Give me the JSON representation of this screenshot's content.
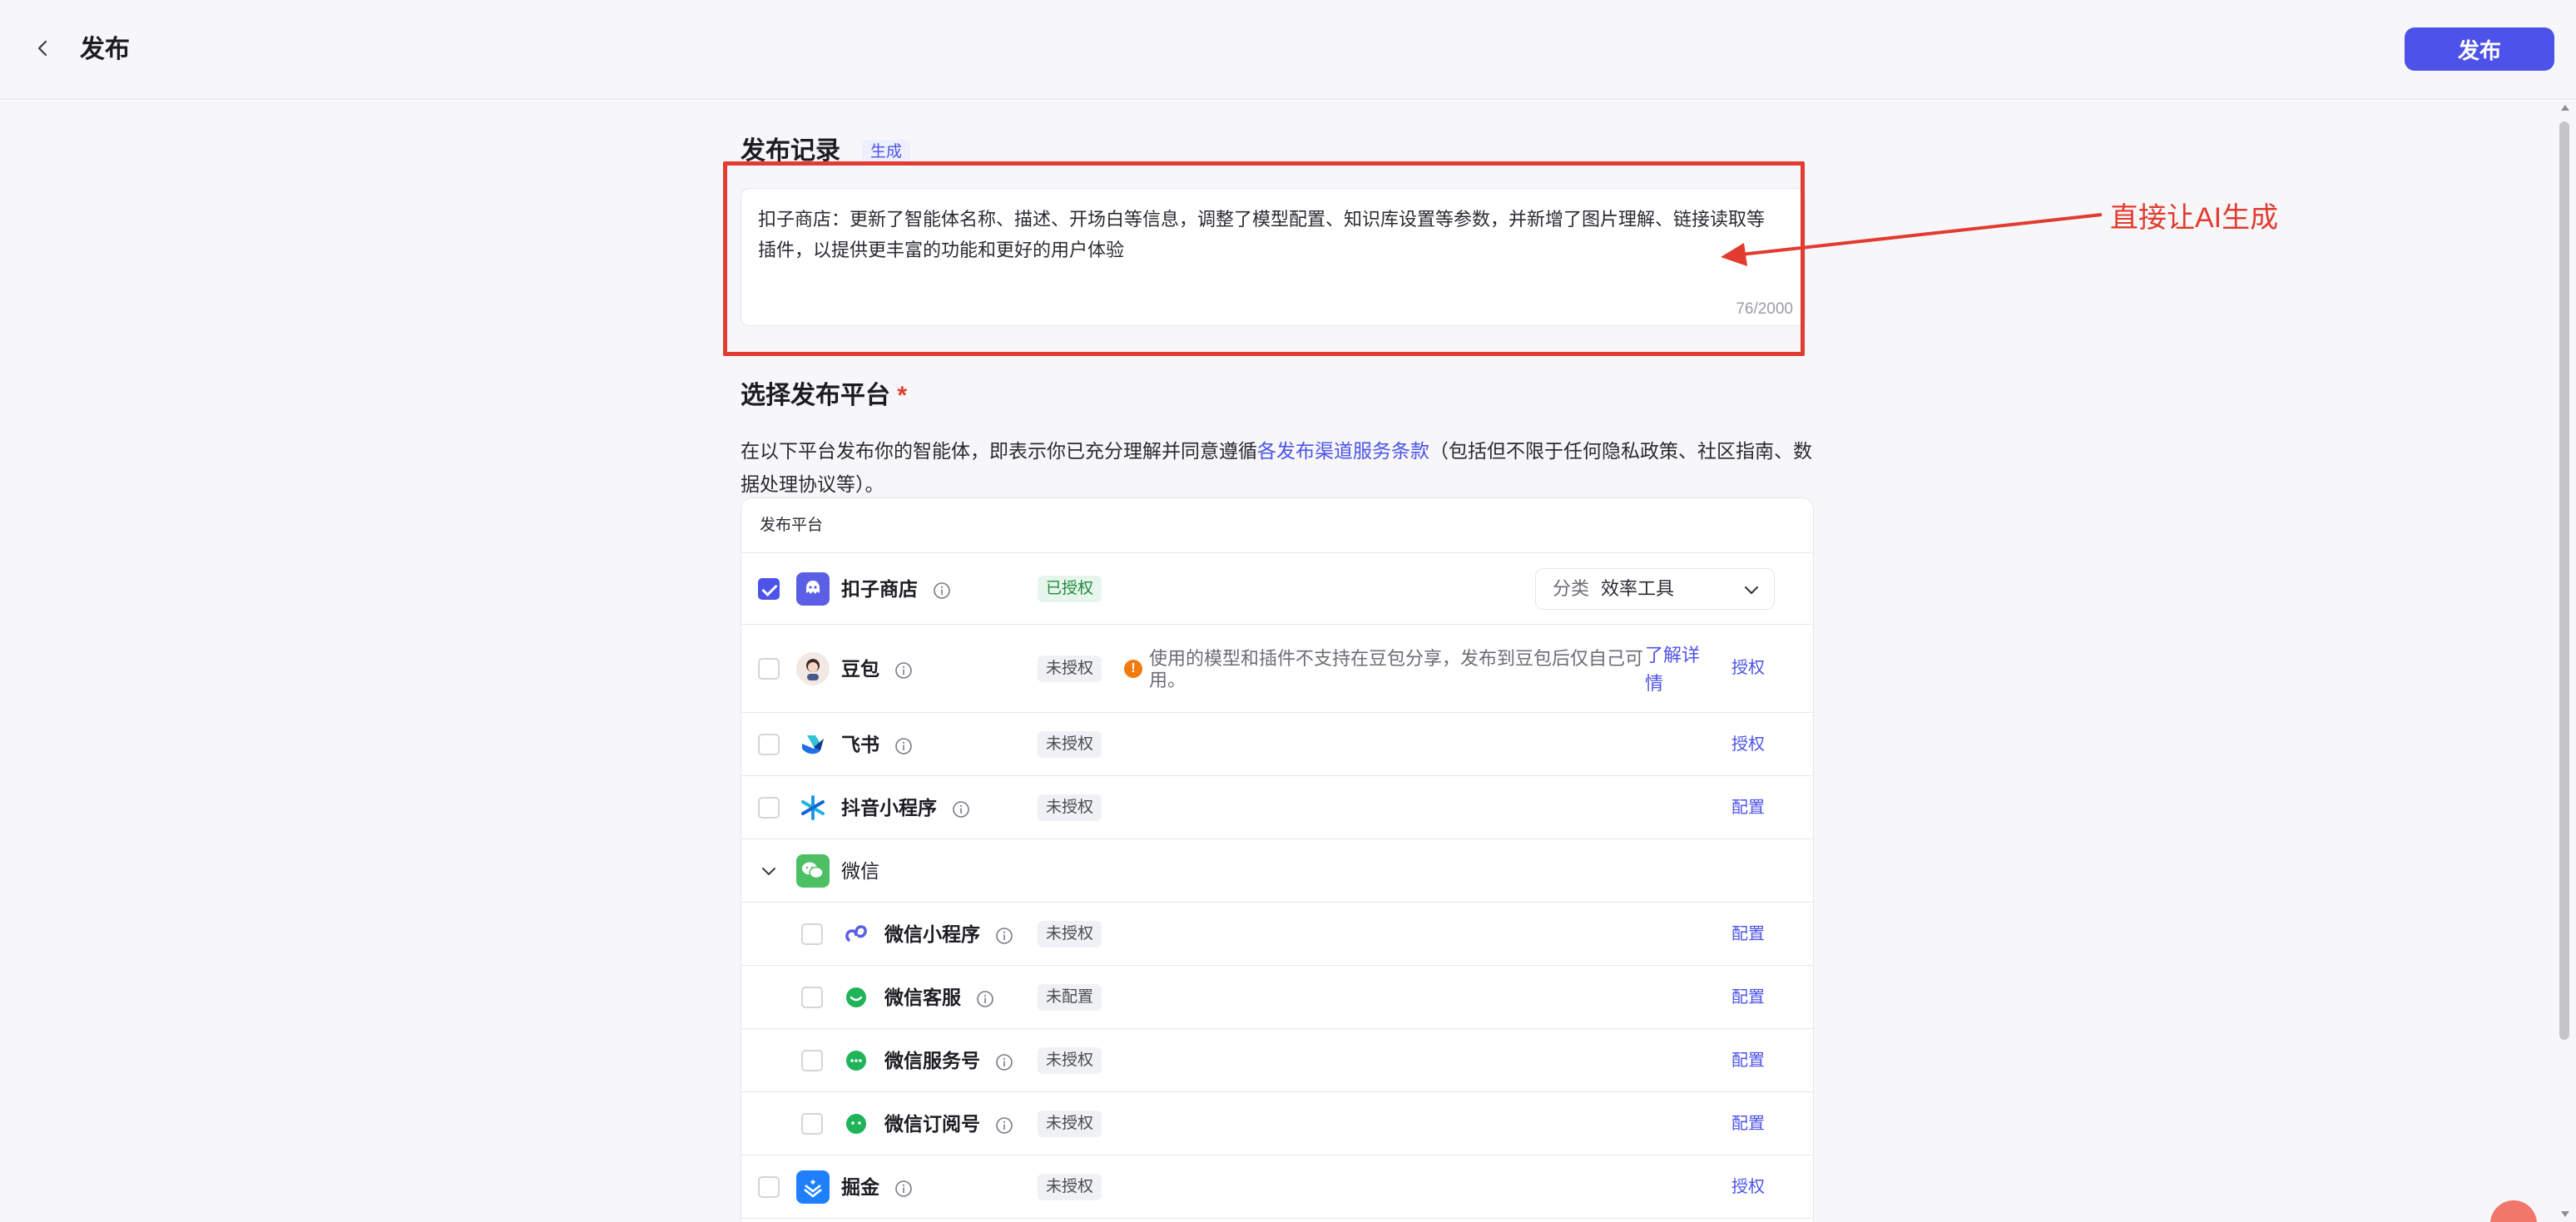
{
  "header": {
    "title": "发布",
    "publish_label": "发布"
  },
  "record": {
    "title": "发布记录",
    "generate_label": "生成",
    "text": "扣子商店：更新了智能体名称、描述、开场白等信息，调整了模型配置、知识库设置等参数，并新增了图片理解、链接读取等插件，以提供更丰富的功能和更好的用户体验",
    "counter": "76/2000"
  },
  "annotation": {
    "text": "直接让AI生成"
  },
  "platform": {
    "title": "选择发布平台",
    "required_mark": "*",
    "notice_before": "在以下平台发布你的智能体，即表示你已充分理解并同意遵循",
    "notice_link": "各发布渠道服务条款",
    "notice_after": "（包括但不限于任何隐私政策、社区指南、数据处理协议等）。",
    "table_header": "发布平台",
    "rows": [
      {
        "name": "扣子商店",
        "status": "已授权",
        "category_label": "分类",
        "category_value": "效率工具"
      },
      {
        "name": "豆包",
        "status": "未授权",
        "warning": "使用的模型和插件不支持在豆包分享，发布到豆包后仅自己可用。",
        "learn_more": "了解详情",
        "action": "授权"
      },
      {
        "name": "飞书",
        "status": "未授权",
        "action": "授权"
      },
      {
        "name": "抖音小程序",
        "status": "未授权",
        "action": "配置"
      },
      {
        "name": "微信"
      },
      {
        "name": "微信小程序",
        "status": "未授权",
        "action": "配置"
      },
      {
        "name": "微信客服",
        "status": "未配置",
        "action": "配置"
      },
      {
        "name": "微信服务号",
        "status": "未授权",
        "action": "配置"
      },
      {
        "name": "微信订阅号",
        "status": "未授权",
        "action": "配置"
      },
      {
        "name": "掘金",
        "status": "未授权",
        "action": "授权"
      }
    ]
  },
  "colors": {
    "accent": "#4D53E8",
    "annotation": "#E23B2F"
  }
}
